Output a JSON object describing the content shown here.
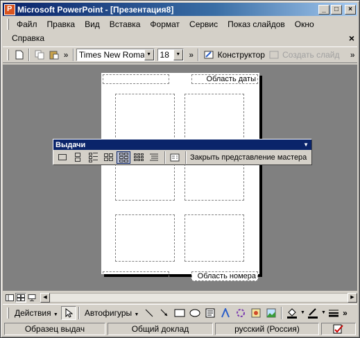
{
  "window": {
    "title": "Microsoft PowerPoint - [Презентация8]",
    "controls": {
      "minimize": "_",
      "restore": "□",
      "close": "×"
    }
  },
  "menu": {
    "row1": [
      "Файл",
      "Правка",
      "Вид",
      "Вставка",
      "Формат",
      "Сервис",
      "Показ слайдов",
      "Окно"
    ],
    "row2": [
      "Справка"
    ],
    "close_doc": "×"
  },
  "toolbar": {
    "font_name": "Times New Roman",
    "font_size": "18",
    "designer_label": "Конструктор",
    "new_slide_label": "Создать слайд",
    "more": "»"
  },
  "page": {
    "header_label": "Область даты",
    "footer_label": "Область номера",
    "handouts_per_page": 6
  },
  "handout_toolbar": {
    "title": "Выдачи",
    "close_master_label": "Закрыть представление мастера",
    "layouts": [
      "1",
      "2",
      "3",
      "4",
      "6",
      "9",
      "outline"
    ],
    "active_layout": "6"
  },
  "drawing_toolbar": {
    "actions_label": "Действия",
    "autoshapes_label": "Автофигуры",
    "icons": [
      "pointer-icon",
      "line-icon",
      "arrow-icon",
      "rectangle-icon",
      "oval-icon",
      "textbox-icon",
      "wordart-icon",
      "diagram-icon",
      "clipart-icon",
      "picture-icon",
      "fill-color-icon",
      "line-color-icon",
      "line-style-icon"
    ]
  },
  "status": {
    "view": "Образец выдач",
    "design": "Общий доклад",
    "language": "русский (Россия)"
  },
  "colors": {
    "titlebar": "#0a246a",
    "chrome": "#d4d0c8",
    "workspace": "#808080"
  }
}
